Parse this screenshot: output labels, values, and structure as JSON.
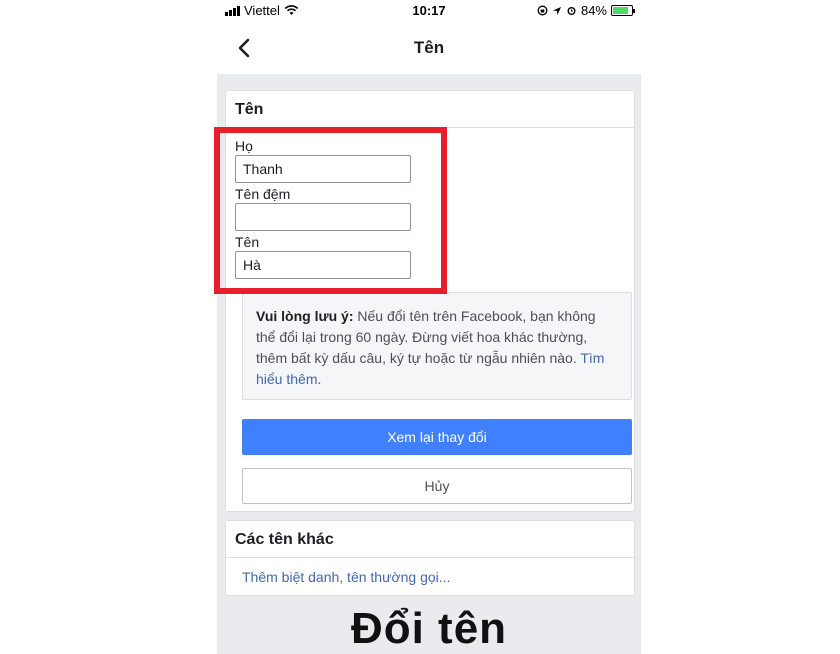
{
  "status_bar": {
    "carrier": "Viettel",
    "time": "10:17",
    "battery": "84%"
  },
  "header": {
    "title": "Tên"
  },
  "name_card": {
    "heading": "Tên",
    "fields": [
      {
        "label": "Họ",
        "value": "Thanh"
      },
      {
        "label": "Tên đệm",
        "value": ""
      },
      {
        "label": "Tên",
        "value": "Hà"
      }
    ],
    "note": {
      "bold": "Vui lòng lưu ý:",
      "text": " Nếu đổi tên trên Facebook, bạn không thể đổi lại trong 60 ngày. Đừng viết hoa khác thường, thêm bất kỳ dấu câu, ký tự hoặc từ ngẫu nhiên nào. ",
      "link": "Tìm hiểu thêm",
      "end": "."
    },
    "review_button": "Xem lại thay đổi",
    "cancel_button": "Hủy"
  },
  "other_names_card": {
    "heading": "Các tên khác",
    "link": "Thêm biệt danh, tên thường gọi..."
  },
  "caption": "Đổi tên",
  "colors": {
    "primary": "#4080ff",
    "highlight": "#e5202a",
    "link": "#4267b2"
  }
}
